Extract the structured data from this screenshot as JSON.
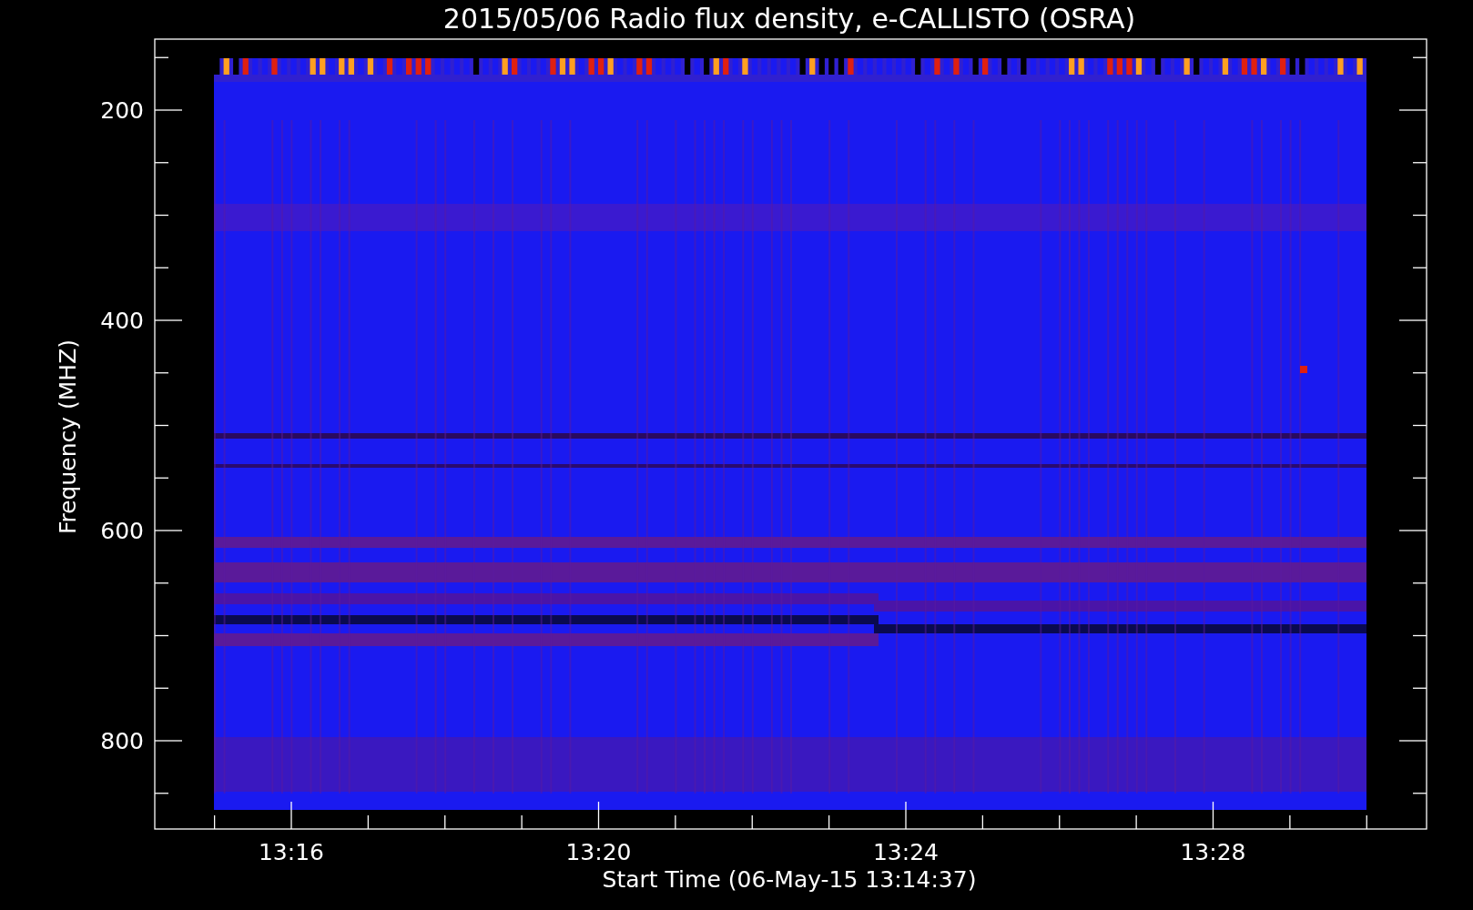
{
  "plot": {
    "title": "2015/05/06  Radio flux density, e-CALLISTO (OSRA)",
    "y_axis": {
      "label": "Frequency (MHZ)",
      "ticks": [
        "200",
        "400",
        "600",
        "800"
      ]
    },
    "x_axis": {
      "label": "Start Time (06-May-15 13:14:37)",
      "ticks": [
        "13:16",
        "13:20",
        "13:24",
        "13:28"
      ]
    }
  }
}
